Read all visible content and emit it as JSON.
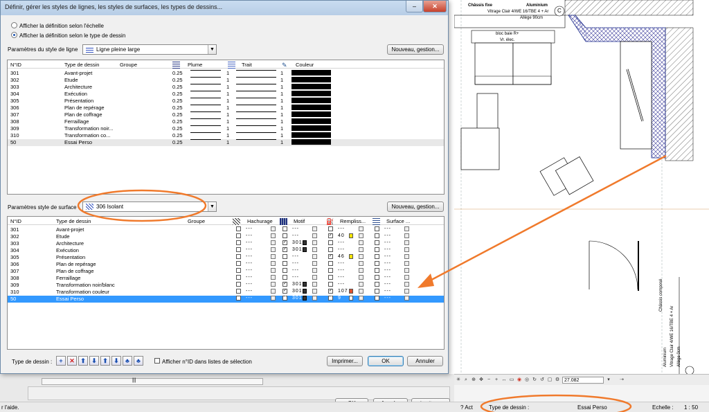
{
  "dialog": {
    "title": "Définir, gérer les styles de lignes, les styles de surfaces, les types de dessins...",
    "close": "✕",
    "minimize": "–",
    "radio_scale": "Afficher la définition selon l'échelle",
    "radio_type": "Afficher la définition selon le type de dessin",
    "line_params_label": "Paramètres du style de ligne",
    "line_style_value": "Ligne pleine large",
    "surface_params_label": "Paramètres style de surface",
    "surface_style_value": "306 Isolant",
    "manage_button": "Nouveau, gestion...",
    "manage_button2": "Nouveau, gestion...",
    "type_label": "Type de dessin :",
    "show_id_label": "Afficher n°ID dans listes de sélection",
    "print_button": "Imprimer...",
    "ok_button": "OK",
    "cancel_button": "Annuler"
  },
  "line_table": {
    "headers": {
      "id": "N°ID",
      "type": "Type de dessin",
      "group": "Groupe",
      "pen": "Plume",
      "stroke": "Trait",
      "color": "Couleur"
    },
    "rows": [
      {
        "id": "301",
        "name": "Avant-projet",
        "pen": "0.25",
        "stroke": "1",
        "color": "1"
      },
      {
        "id": "302",
        "name": "Etude",
        "pen": "0.25",
        "stroke": "1",
        "color": "1"
      },
      {
        "id": "303",
        "name": "Architecture",
        "pen": "0.25",
        "stroke": "1",
        "color": "1"
      },
      {
        "id": "304",
        "name": "Exécution",
        "pen": "0.25",
        "stroke": "1",
        "color": "1"
      },
      {
        "id": "305",
        "name": "Présentation",
        "pen": "0.25",
        "stroke": "1",
        "color": "1"
      },
      {
        "id": "306",
        "name": "Plan de repérage",
        "pen": "0.25",
        "stroke": "1",
        "color": "1"
      },
      {
        "id": "307",
        "name": "Plan de coffrage",
        "pen": "0.25",
        "stroke": "1",
        "color": "1"
      },
      {
        "id": "308",
        "name": "Ferraillage",
        "pen": "0.25",
        "stroke": "1",
        "color": "1"
      },
      {
        "id": "309",
        "name": "Transformation noir...",
        "pen": "0.25",
        "stroke": "1",
        "color": "1"
      },
      {
        "id": "310",
        "name": "Transformation co...",
        "pen": "0.25",
        "stroke": "1",
        "color": "1"
      },
      {
        "id": "50",
        "name": "Essai Perso",
        "pen": "0.25",
        "stroke": "1",
        "color": "1"
      }
    ]
  },
  "surface_table": {
    "headers": {
      "id": "N°ID",
      "type": "Type de dessin",
      "group": "Groupe",
      "hatch": "Hachurage",
      "pattern": "Motif",
      "fill": "Rempliss...",
      "surface": "Surface ..."
    },
    "rows": [
      {
        "id": "301",
        "name": "Avant-projet",
        "hatch": false,
        "hatch_val": "---",
        "motif": false,
        "motif_val": "---",
        "fill": false,
        "fill_val": "---",
        "surf": false,
        "surf_val": "---"
      },
      {
        "id": "302",
        "name": "Etude",
        "hatch": false,
        "hatch_val": "---",
        "motif": false,
        "motif_val": "---",
        "fill": true,
        "fill_val": "40",
        "fill_color": "#f5e400",
        "surf": false,
        "surf_val": "---"
      },
      {
        "id": "303",
        "name": "Architecture",
        "hatch": false,
        "hatch_val": "---",
        "motif": true,
        "motif_val": "301",
        "fill": false,
        "fill_val": "---",
        "surf": false,
        "surf_val": "---"
      },
      {
        "id": "304",
        "name": "Exécution",
        "hatch": false,
        "hatch_val": "---",
        "motif": true,
        "motif_val": "301",
        "fill": false,
        "fill_val": "---",
        "surf": false,
        "surf_val": "---"
      },
      {
        "id": "305",
        "name": "Présentation",
        "hatch": false,
        "hatch_val": "---",
        "motif": false,
        "motif_val": "---",
        "fill": true,
        "fill_val": "46",
        "fill_color": "#f5e400",
        "surf": false,
        "surf_val": "---"
      },
      {
        "id": "306",
        "name": "Plan de repérage",
        "hatch": false,
        "hatch_val": "---",
        "motif": false,
        "motif_val": "---",
        "fill": false,
        "fill_val": "---",
        "surf": false,
        "surf_val": "---"
      },
      {
        "id": "307",
        "name": "Plan de coffrage",
        "hatch": false,
        "hatch_val": "---",
        "motif": false,
        "motif_val": "---",
        "fill": false,
        "fill_val": "---",
        "surf": false,
        "surf_val": "---"
      },
      {
        "id": "308",
        "name": "Ferraillage",
        "hatch": false,
        "hatch_val": "---",
        "motif": false,
        "motif_val": "---",
        "fill": false,
        "fill_val": "---",
        "surf": false,
        "surf_val": "---"
      },
      {
        "id": "309",
        "name": "Transformation noir/blanc",
        "hatch": false,
        "hatch_val": "---",
        "motif": true,
        "motif_val": "301",
        "fill": false,
        "fill_val": "---",
        "surf": false,
        "surf_val": "---"
      },
      {
        "id": "310",
        "name": "Transformation couleur",
        "hatch": false,
        "hatch_val": "---",
        "motif": true,
        "motif_val": "301",
        "fill": true,
        "fill_val": "107",
        "fill_color": "#e0502a",
        "surf": false,
        "surf_val": "---"
      },
      {
        "id": "50",
        "name": "Essai Perso",
        "hatch": false,
        "hatch_val": "---",
        "motif": true,
        "motif_val": "301",
        "fill": true,
        "fill_val": "9",
        "fill_color": "#ffffff",
        "surf": false,
        "surf_val": "---"
      }
    ]
  },
  "type_toolbar": [
    "+",
    "✕",
    "⬆",
    "⬇",
    "⬆",
    "⬇",
    "♣",
    "♣"
  ],
  "background": {
    "ok": "OK",
    "cancel": "Annuler",
    "apply": "Appliquer",
    "scroll_text": "|||"
  },
  "cad": {
    "label_chassis": "Châssis fixe",
    "label_alu": "Aluminium",
    "label_vitrage": "Vitrage Clair 4/WE 16/TBE 4 + Ar",
    "label_allege": "Allège 90cm",
    "label_circle": "C",
    "label_bloc": "bloc baie R+",
    "label_vr": "Vr. élec.",
    "vertical_1": "Châssis composé",
    "vertical_2": "Aluminium",
    "vertical_3": "Vitrage Clair 4/WE 16/TBE 4 + Ar",
    "vertical_4": "Allège 0cm",
    "zoom_value": "27.082"
  },
  "status": {
    "help": "r l'aide.",
    "act": "? Act",
    "type_label": "Type de dessin :",
    "type_value": "Essai Perso",
    "scale_label": "Echelle :",
    "scale_value": "1 : 50"
  },
  "colors": {
    "highlight": "#3399ff",
    "annotation": "#f07a2c"
  }
}
